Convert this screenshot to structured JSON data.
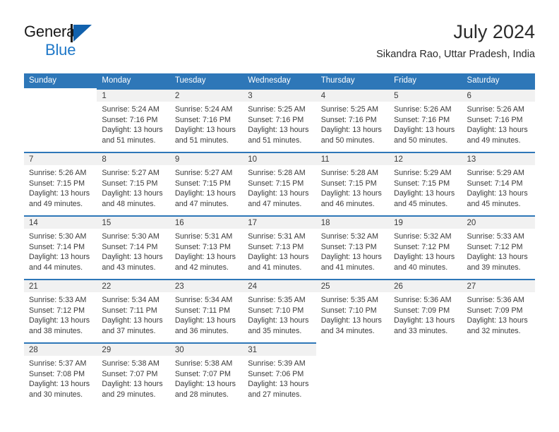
{
  "brand": {
    "word1": "General",
    "word2": "Blue",
    "triangle_color": "#1161AD",
    "blue_text_color": "#1F78C8",
    "logo_icon": "triangle-flag-icon"
  },
  "header": {
    "title": "July 2024",
    "subtitle": "Sikandra Rao, Uttar Pradesh, India"
  },
  "theme": {
    "header_row_bg": "#2E77B8",
    "header_row_text": "#FFFFFF",
    "daynum_band_bg": "#F1F1F1",
    "cell_text": "#3A3A3A",
    "row_divider": "#2E77B8"
  },
  "weekdays": [
    "Sunday",
    "Monday",
    "Tuesday",
    "Wednesday",
    "Thursday",
    "Friday",
    "Saturday"
  ],
  "labels": {
    "sunrise_prefix": "Sunrise:",
    "sunset_prefix": "Sunset:",
    "daylight_prefix": "Daylight:"
  },
  "weeks": [
    [
      {
        "day": "",
        "lines": []
      },
      {
        "day": "1",
        "lines": [
          "Sunrise: 5:24 AM",
          "Sunset: 7:16 PM",
          "Daylight: 13 hours",
          "and 51 minutes."
        ]
      },
      {
        "day": "2",
        "lines": [
          "Sunrise: 5:24 AM",
          "Sunset: 7:16 PM",
          "Daylight: 13 hours",
          "and 51 minutes."
        ]
      },
      {
        "day": "3",
        "lines": [
          "Sunrise: 5:25 AM",
          "Sunset: 7:16 PM",
          "Daylight: 13 hours",
          "and 51 minutes."
        ]
      },
      {
        "day": "4",
        "lines": [
          "Sunrise: 5:25 AM",
          "Sunset: 7:16 PM",
          "Daylight: 13 hours",
          "and 50 minutes."
        ]
      },
      {
        "day": "5",
        "lines": [
          "Sunrise: 5:26 AM",
          "Sunset: 7:16 PM",
          "Daylight: 13 hours",
          "and 50 minutes."
        ]
      },
      {
        "day": "6",
        "lines": [
          "Sunrise: 5:26 AM",
          "Sunset: 7:16 PM",
          "Daylight: 13 hours",
          "and 49 minutes."
        ]
      }
    ],
    [
      {
        "day": "7",
        "lines": [
          "Sunrise: 5:26 AM",
          "Sunset: 7:15 PM",
          "Daylight: 13 hours",
          "and 49 minutes."
        ]
      },
      {
        "day": "8",
        "lines": [
          "Sunrise: 5:27 AM",
          "Sunset: 7:15 PM",
          "Daylight: 13 hours",
          "and 48 minutes."
        ]
      },
      {
        "day": "9",
        "lines": [
          "Sunrise: 5:27 AM",
          "Sunset: 7:15 PM",
          "Daylight: 13 hours",
          "and 47 minutes."
        ]
      },
      {
        "day": "10",
        "lines": [
          "Sunrise: 5:28 AM",
          "Sunset: 7:15 PM",
          "Daylight: 13 hours",
          "and 47 minutes."
        ]
      },
      {
        "day": "11",
        "lines": [
          "Sunrise: 5:28 AM",
          "Sunset: 7:15 PM",
          "Daylight: 13 hours",
          "and 46 minutes."
        ]
      },
      {
        "day": "12",
        "lines": [
          "Sunrise: 5:29 AM",
          "Sunset: 7:15 PM",
          "Daylight: 13 hours",
          "and 45 minutes."
        ]
      },
      {
        "day": "13",
        "lines": [
          "Sunrise: 5:29 AM",
          "Sunset: 7:14 PM",
          "Daylight: 13 hours",
          "and 45 minutes."
        ]
      }
    ],
    [
      {
        "day": "14",
        "lines": [
          "Sunrise: 5:30 AM",
          "Sunset: 7:14 PM",
          "Daylight: 13 hours",
          "and 44 minutes."
        ]
      },
      {
        "day": "15",
        "lines": [
          "Sunrise: 5:30 AM",
          "Sunset: 7:14 PM",
          "Daylight: 13 hours",
          "and 43 minutes."
        ]
      },
      {
        "day": "16",
        "lines": [
          "Sunrise: 5:31 AM",
          "Sunset: 7:13 PM",
          "Daylight: 13 hours",
          "and 42 minutes."
        ]
      },
      {
        "day": "17",
        "lines": [
          "Sunrise: 5:31 AM",
          "Sunset: 7:13 PM",
          "Daylight: 13 hours",
          "and 41 minutes."
        ]
      },
      {
        "day": "18",
        "lines": [
          "Sunrise: 5:32 AM",
          "Sunset: 7:13 PM",
          "Daylight: 13 hours",
          "and 41 minutes."
        ]
      },
      {
        "day": "19",
        "lines": [
          "Sunrise: 5:32 AM",
          "Sunset: 7:12 PM",
          "Daylight: 13 hours",
          "and 40 minutes."
        ]
      },
      {
        "day": "20",
        "lines": [
          "Sunrise: 5:33 AM",
          "Sunset: 7:12 PM",
          "Daylight: 13 hours",
          "and 39 minutes."
        ]
      }
    ],
    [
      {
        "day": "21",
        "lines": [
          "Sunrise: 5:33 AM",
          "Sunset: 7:12 PM",
          "Daylight: 13 hours",
          "and 38 minutes."
        ]
      },
      {
        "day": "22",
        "lines": [
          "Sunrise: 5:34 AM",
          "Sunset: 7:11 PM",
          "Daylight: 13 hours",
          "and 37 minutes."
        ]
      },
      {
        "day": "23",
        "lines": [
          "Sunrise: 5:34 AM",
          "Sunset: 7:11 PM",
          "Daylight: 13 hours",
          "and 36 minutes."
        ]
      },
      {
        "day": "24",
        "lines": [
          "Sunrise: 5:35 AM",
          "Sunset: 7:10 PM",
          "Daylight: 13 hours",
          "and 35 minutes."
        ]
      },
      {
        "day": "25",
        "lines": [
          "Sunrise: 5:35 AM",
          "Sunset: 7:10 PM",
          "Daylight: 13 hours",
          "and 34 minutes."
        ]
      },
      {
        "day": "26",
        "lines": [
          "Sunrise: 5:36 AM",
          "Sunset: 7:09 PM",
          "Daylight: 13 hours",
          "and 33 minutes."
        ]
      },
      {
        "day": "27",
        "lines": [
          "Sunrise: 5:36 AM",
          "Sunset: 7:09 PM",
          "Daylight: 13 hours",
          "and 32 minutes."
        ]
      }
    ],
    [
      {
        "day": "28",
        "lines": [
          "Sunrise: 5:37 AM",
          "Sunset: 7:08 PM",
          "Daylight: 13 hours",
          "and 30 minutes."
        ]
      },
      {
        "day": "29",
        "lines": [
          "Sunrise: 5:38 AM",
          "Sunset: 7:07 PM",
          "Daylight: 13 hours",
          "and 29 minutes."
        ]
      },
      {
        "day": "30",
        "lines": [
          "Sunrise: 5:38 AM",
          "Sunset: 7:07 PM",
          "Daylight: 13 hours",
          "and 28 minutes."
        ]
      },
      {
        "day": "31",
        "lines": [
          "Sunrise: 5:39 AM",
          "Sunset: 7:06 PM",
          "Daylight: 13 hours",
          "and 27 minutes."
        ]
      },
      {
        "day": "",
        "lines": []
      },
      {
        "day": "",
        "lines": []
      },
      {
        "day": "",
        "lines": []
      }
    ]
  ]
}
